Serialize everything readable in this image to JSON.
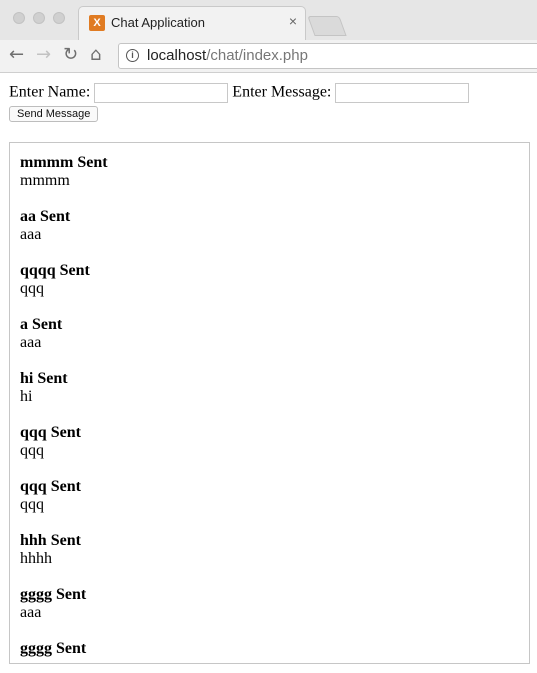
{
  "browser": {
    "tab_title": "Chat Application",
    "tab_close": "×",
    "favicon_letter": "X",
    "url_host": "localhost",
    "url_path": "/chat/index.php"
  },
  "form": {
    "name_label": "Enter Name:",
    "name_value": "",
    "message_label": "Enter Message:",
    "message_value": "",
    "send_label": "Send Message"
  },
  "messages": [
    {
      "header": "mmmm Sent",
      "body": "mmmm"
    },
    {
      "header": "aa Sent",
      "body": "aaa"
    },
    {
      "header": "qqqq Sent",
      "body": "qqq"
    },
    {
      "header": "a Sent",
      "body": "aaa"
    },
    {
      "header": "hi Sent",
      "body": "hi"
    },
    {
      "header": "qqq Sent",
      "body": "qqq"
    },
    {
      "header": "qqq Sent",
      "body": "qqq"
    },
    {
      "header": "hhh Sent",
      "body": "hhhh"
    },
    {
      "header": "gggg Sent",
      "body": "aaa"
    },
    {
      "header": "gggg Sent",
      "body": ""
    }
  ]
}
